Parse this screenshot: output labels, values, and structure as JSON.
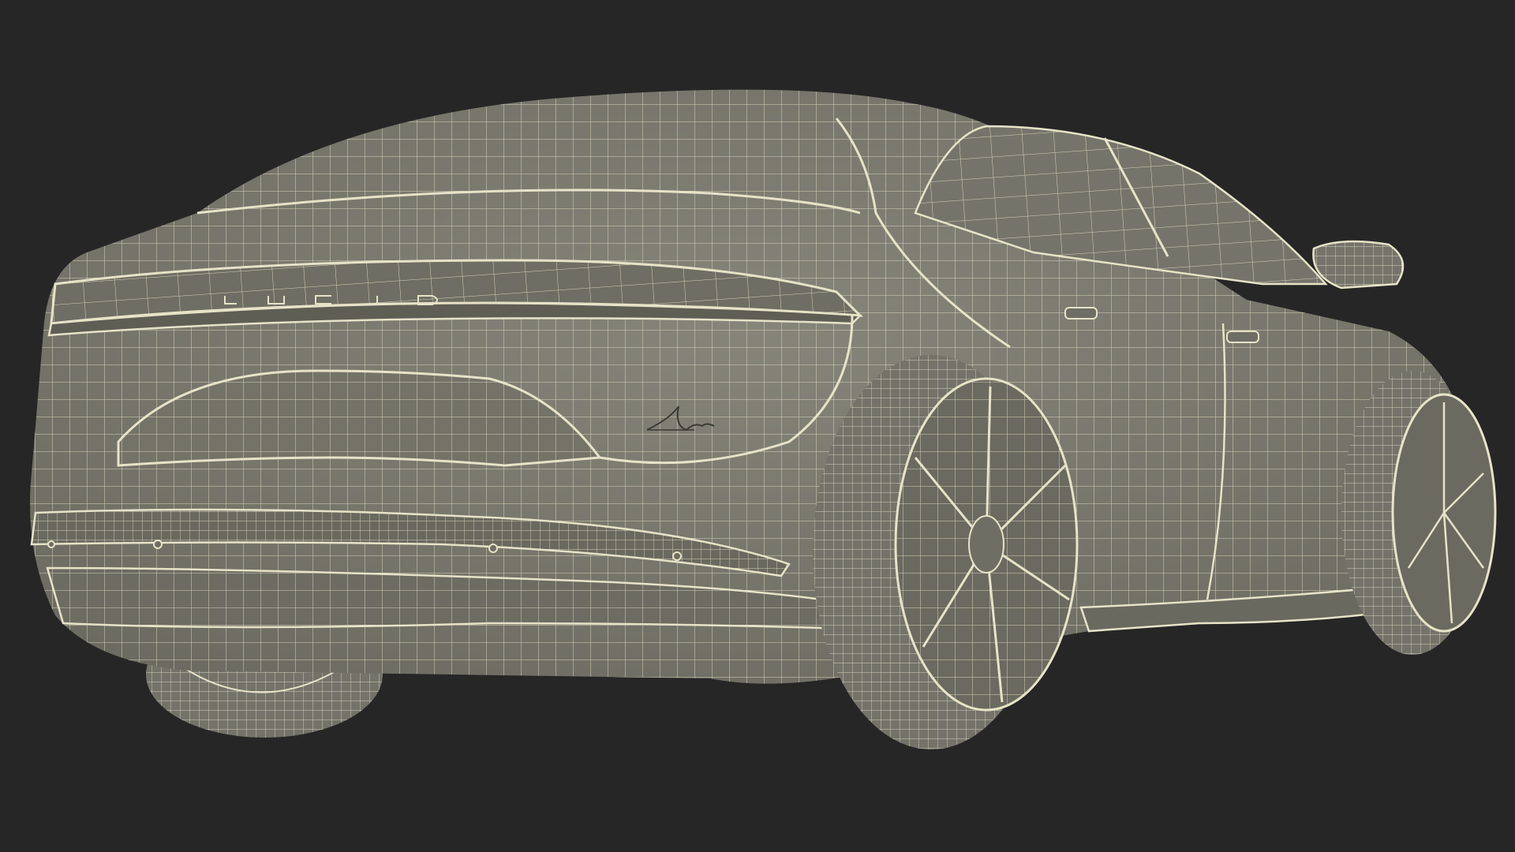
{
  "scene": {
    "background_color": "#262626",
    "surface_color": "#7e7d71",
    "wire_color": "#e6e3c8",
    "shadow_color": "#5f5e55",
    "subject": "car-wireframe-render"
  },
  "badges": {
    "rear_wordmark": "LUCID",
    "trim_badge": "Air"
  }
}
